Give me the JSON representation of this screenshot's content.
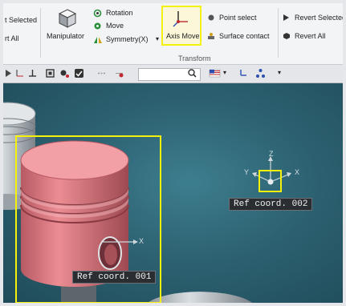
{
  "ribbon": {
    "left_group": {
      "revert_selected": "t Selected",
      "revert_all": "rt All"
    },
    "manipulator_label": "Manipulator",
    "rotation_label": "Rotation",
    "move_label": "Move",
    "symmetry_label": "Symmetry(X)",
    "axis_move_label": "Axis Move",
    "point_select_label": "Point select",
    "surface_contact_label": "Surface contact",
    "revert_selected_label": "Revert Selected",
    "revert_all_label": "Revert All",
    "group_title": "Transform"
  },
  "toolbar": {
    "search_placeholder": ""
  },
  "viewport": {
    "ref_coord_1": "Ref coord. 001",
    "ref_coord_2": "Ref coord. 002",
    "axis_x": "X",
    "axis_y": "Y",
    "axis_z": "Z"
  },
  "colors": {
    "highlight": "#f5f10a",
    "piston": "#e8828a",
    "viewport_bg": "#2d6272"
  }
}
